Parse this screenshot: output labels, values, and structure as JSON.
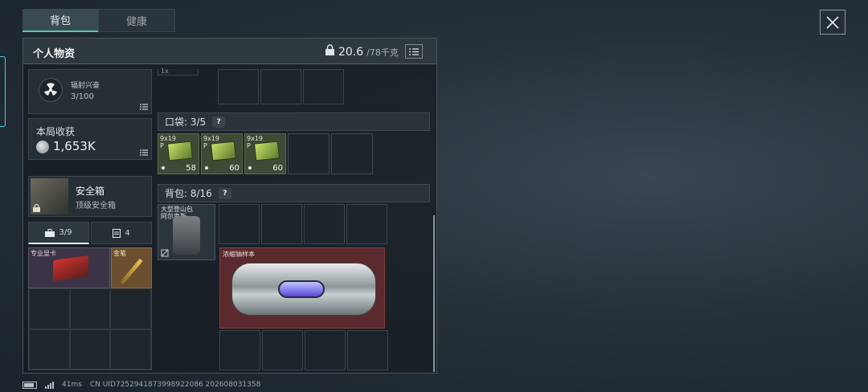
{
  "tabs": [
    {
      "label": "背包",
      "active": true
    },
    {
      "label": "健康",
      "active": false
    }
  ],
  "panel": {
    "title": "个人物资",
    "weight_current": "20.6",
    "weight_max": "/78千克"
  },
  "radiation": {
    "label": "辐射兴奋",
    "value": "3/100"
  },
  "loot": {
    "label": "本局收获",
    "value": "1,653K"
  },
  "safe_box": {
    "name": "安全箱",
    "subtitle": "顶级安全箱"
  },
  "safe_tabs": [
    {
      "label": "3/9",
      "icon": "briefcase-icon"
    },
    {
      "label": "4",
      "icon": "clipboard-icon"
    }
  ],
  "safe_items": [
    {
      "name": "专业显卡",
      "color": "#3b3446"
    },
    {
      "name": "金笔",
      "color": "#6c4f2e"
    }
  ],
  "top_partial_label": "1x",
  "pocket": {
    "label": "口袋: 3/5",
    "help": "?",
    "items": [
      {
        "name": "9x19\nP",
        "count": "58"
      },
      {
        "name": "9x19\nP",
        "count": "60"
      },
      {
        "name": "9x19\nP",
        "count": "60"
      }
    ]
  },
  "backpack": {
    "label": "背包: 8/16",
    "help": "?",
    "bag_item_name": "大型登山包\n阿尔卑斯",
    "canister_name": "浓缩铀样本"
  },
  "status": {
    "ping": "41ms",
    "uid": "CN UID7252941873998922086 202608031358"
  },
  "colors": {
    "accent": "#4fd0a8",
    "canister_bg": "#5a2a2e",
    "ammo_bg": "#3e4a36"
  }
}
